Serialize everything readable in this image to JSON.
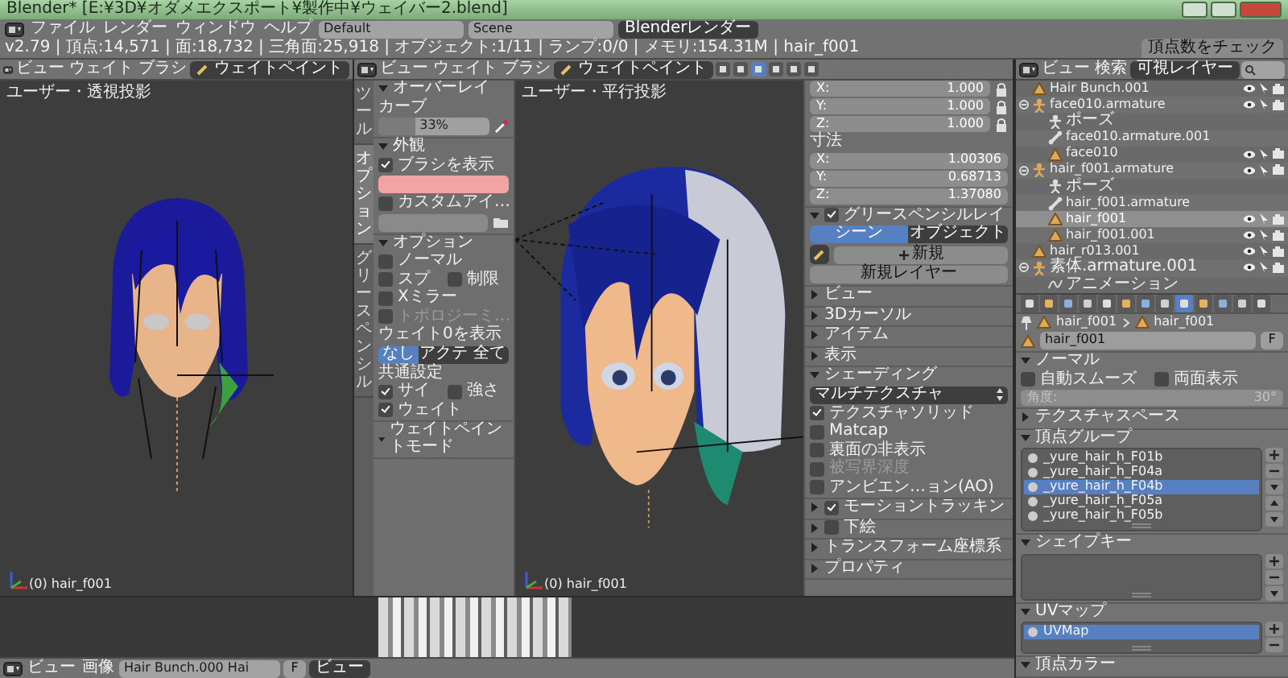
{
  "title_bar": {
    "title": "Blender* [E:¥3D¥オダメエクスポート¥製作中¥ウェイバー2.blend]"
  },
  "info_header": {
    "menus": [
      "ファイル",
      "レンダー",
      "ウィンドウ",
      "ヘルプ"
    ],
    "layout": "Default",
    "scene": "Scene",
    "engine": "Blenderレンダー",
    "stats": "v2.79 | 頂点:14,571 | 面:18,732 | 三角面:25,918 | オブジェクト:1/11 | ランプ:0/0 | メモリ:154.31M | hair_f001",
    "addon_tab": "頂点数をチェック"
  },
  "left_viewport": {
    "menus": [
      "ビュー",
      "ウェイト",
      "ブラシ"
    ],
    "mode": "ウェイトペイント",
    "view_label": "ユーザー・透視投影",
    "object_label": "(0) hair_f001"
  },
  "main_viewport": {
    "menus": [
      "ビュー",
      "ウェイト",
      "ブラシ"
    ],
    "mode": "ウェイトペイント",
    "view_label": "ユーザー・平行投影",
    "object_label": "(0) hair_f001"
  },
  "tool_shelf": {
    "tabs": [
      {
        "label": "ツール",
        "selected": false
      },
      {
        "label": "オプション",
        "selected": true
      },
      {
        "label": "グリースペンシル",
        "selected": false
      }
    ],
    "panels": [
      {
        "title": "オーバーレイ",
        "expanded": true,
        "items": [
          {
            "kind": "label",
            "text": "カーブ"
          },
          {
            "kind": "slider",
            "text": "33%",
            "level": 0.33
          }
        ]
      },
      {
        "title": "外観",
        "expanded": true,
        "items": [
          {
            "kind": "checkbox",
            "text": "ブラシを表示",
            "checked": true
          },
          {
            "kind": "swatch",
            "color": "#f4a3a3"
          },
          {
            "kind": "checkbox",
            "text": "カスタムアイ…",
            "checked": false
          },
          {
            "kind": "field"
          }
        ]
      },
      {
        "title": "オプション",
        "expanded": true,
        "items": [
          {
            "kind": "checkbox",
            "text": "ノーマル",
            "checked": false,
            "disabled": false
          },
          {
            "kind": "pair",
            "checks": [
              {
                "text": "スプ",
                "checked": false
              },
              {
                "text": "制限",
                "checked": false
              }
            ]
          },
          {
            "kind": "checkbox",
            "text": "Xミラー",
            "checked": false,
            "disabled": false
          },
          {
            "kind": "checkbox",
            "text": "トポロジーミ…",
            "checked": false,
            "disabled": true
          },
          {
            "kind": "label",
            "text": "ウェイト0を表示"
          },
          {
            "kind": "segmented",
            "options": [
              {
                "text": "なし",
                "selected": true
              },
              {
                "text": "アクテ",
                "selected": false
              },
              {
                "text": "全て",
                "selected": false
              }
            ]
          },
          {
            "kind": "label",
            "text": "共通設定"
          },
          {
            "kind": "pair",
            "checks": [
              {
                "text": "サイ",
                "checked": true
              },
              {
                "text": "強さ",
                "checked": false
              }
            ]
          },
          {
            "kind": "checkbox",
            "text": "ウェイト",
            "checked": true,
            "disabled": false
          }
        ]
      },
      {
        "title": "ウェイトペイントモード",
        "expanded": true
      }
    ]
  },
  "n_panel": {
    "sections": [
      {
        "items": [
          {
            "kind": "vector",
            "locks": true,
            "fields": [
              {
                "axis": "X:",
                "value": "1.000"
              },
              {
                "axis": "Y:",
                "value": "1.000"
              },
              {
                "axis": "Z:",
                "value": "1.000"
              }
            ]
          },
          {
            "kind": "label",
            "text": "寸法"
          },
          {
            "kind": "vector",
            "locks": false,
            "fields": [
              {
                "axis": "X:",
                "value": "1.00306"
              },
              {
                "axis": "Y:",
                "value": "0.68713"
              },
              {
                "axis": "Z:",
                "value": "1.37080"
              }
            ]
          }
        ]
      },
      {
        "title": "グリースペンシルレイ",
        "expanded": true,
        "checked": true,
        "items": [
          {
            "kind": "segmented",
            "options": [
              {
                "text": "シーン",
                "selected": true
              },
              {
                "text": "オブジェクト",
                "selected": false
              }
            ]
          },
          {
            "kind": "new_row",
            "text": "新規"
          },
          {
            "kind": "button",
            "text": "新規レイヤー"
          }
        ]
      },
      {
        "title": "ビュー",
        "expanded": false
      },
      {
        "title": "3Dカーソル",
        "expanded": false
      },
      {
        "title": "アイテム",
        "expanded": false
      },
      {
        "title": "表示",
        "expanded": false
      },
      {
        "title": "シェーディング",
        "expanded": true,
        "items": [
          {
            "kind": "dropdown",
            "text": "マルチテクスチャ"
          },
          {
            "kind": "checkbox",
            "text": "テクスチャソリッド",
            "checked": true,
            "disabled": false
          },
          {
            "kind": "checkbox",
            "text": "Matcap",
            "checked": false,
            "disabled": false
          },
          {
            "kind": "checkbox",
            "text": "裏面の非表示",
            "checked": false,
            "disabled": false
          },
          {
            "kind": "checkbox",
            "text": "被写界深度",
            "checked": false,
            "disabled": true
          },
          {
            "kind": "checkbox",
            "text": "アンビエン…ョン(AO)",
            "checked": false,
            "disabled": false
          }
        ]
      },
      {
        "title": "モーショントラッキン",
        "expanded": false,
        "checked": true
      },
      {
        "title": "下絵",
        "expanded": false,
        "checked": false
      },
      {
        "title": "トランスフォーム座標系",
        "expanded": false
      },
      {
        "title": "プロパティ",
        "expanded": false
      }
    ]
  },
  "outliner": {
    "menus": [
      "ビュー",
      "検索"
    ],
    "filter": "可視レイヤー",
    "rows": [
      {
        "kind": "mesh",
        "label": "Hair Bunch.001",
        "selected": false
      },
      {
        "kind": "armature",
        "label": "face010.armature",
        "selected": false,
        "children": [
          {
            "kind": "pose",
            "label": "ポーズ",
            "selected": false
          },
          {
            "kind": "armature_data",
            "label": "face010.armature.001",
            "selected": false
          },
          {
            "kind": "mesh",
            "label": "face010",
            "selected": false
          }
        ]
      },
      {
        "kind": "armature",
        "label": "hair_f001.armature",
        "selected": false,
        "children": [
          {
            "kind": "pose",
            "label": "ポーズ",
            "selected": false
          },
          {
            "kind": "armature_data",
            "label": "hair_f001.armature",
            "selected": false
          },
          {
            "kind": "mesh",
            "label": "hair_f001",
            "selected": true
          },
          {
            "kind": "mesh",
            "label": "hair_f001.001",
            "selected": false
          }
        ]
      },
      {
        "kind": "mesh",
        "label": "hair_r013.001",
        "selected": false
      },
      {
        "kind": "armature",
        "label": "素体.armature.001",
        "selected": false,
        "children": [
          {
            "kind": "animation",
            "label": "アニメーション",
            "selected": false
          }
        ]
      }
    ]
  },
  "properties": {
    "tabs": [
      {
        "selected": false
      },
      {
        "selected": false
      },
      {
        "selected": false
      },
      {
        "selected": false
      },
      {
        "selected": false
      },
      {
        "selected": false
      },
      {
        "selected": false
      },
      {
        "selected": false
      },
      {
        "selected": true
      },
      {
        "selected": false
      },
      {
        "selected": false
      },
      {
        "selected": false
      },
      {
        "selected": false
      }
    ],
    "breadcrumb": [
      "hair_f001",
      "hair_f001"
    ],
    "name": "hair_f001",
    "fake_user": "F",
    "sections": [
      {
        "title": "ノーマル",
        "expanded": true,
        "items": [
          {
            "kind": "pair",
            "checks": [
              {
                "text": "自動スムーズ",
                "checked": false
              },
              {
                "text": "両面表示",
                "checked": false
              }
            ]
          },
          {
            "kind": "number",
            "label": "角度:",
            "text": "30°",
            "disabled": true
          }
        ]
      },
      {
        "title": "テクスチャスペース",
        "expanded": false
      },
      {
        "title": "頂点グループ",
        "expanded": true,
        "items": [
          {
            "kind": "list",
            "menu": true,
            "reorder": true,
            "entries": [
              {
                "label": "_yure_hair_h_F01b",
                "selected": false
              },
              {
                "label": "_yure_hair_h_F04a",
                "selected": false
              },
              {
                "label": "_yure_hair_h_F04b",
                "selected": true
              },
              {
                "label": "_yure_hair_h_F05a",
                "selected": false
              },
              {
                "label": "_yure_hair_h_F05b",
                "selected": false
              }
            ]
          }
        ]
      },
      {
        "title": "シェイプキー",
        "expanded": true,
        "items": [
          {
            "kind": "list",
            "menu": true,
            "reorder": false
          }
        ]
      },
      {
        "title": "UVマップ",
        "expanded": true,
        "items": [
          {
            "kind": "list",
            "menu": false,
            "reorder": false,
            "entries": [
              {
                "label": "UVMap",
                "selected": true
              }
            ]
          }
        ]
      },
      {
        "title": "頂点カラー",
        "expanded": true
      }
    ]
  },
  "image_editor": {
    "menus": [
      "ビュー",
      "画像"
    ],
    "image": "Hair Bunch.000 Hai",
    "fake_user": "F",
    "view_menu": "ビュー"
  }
}
